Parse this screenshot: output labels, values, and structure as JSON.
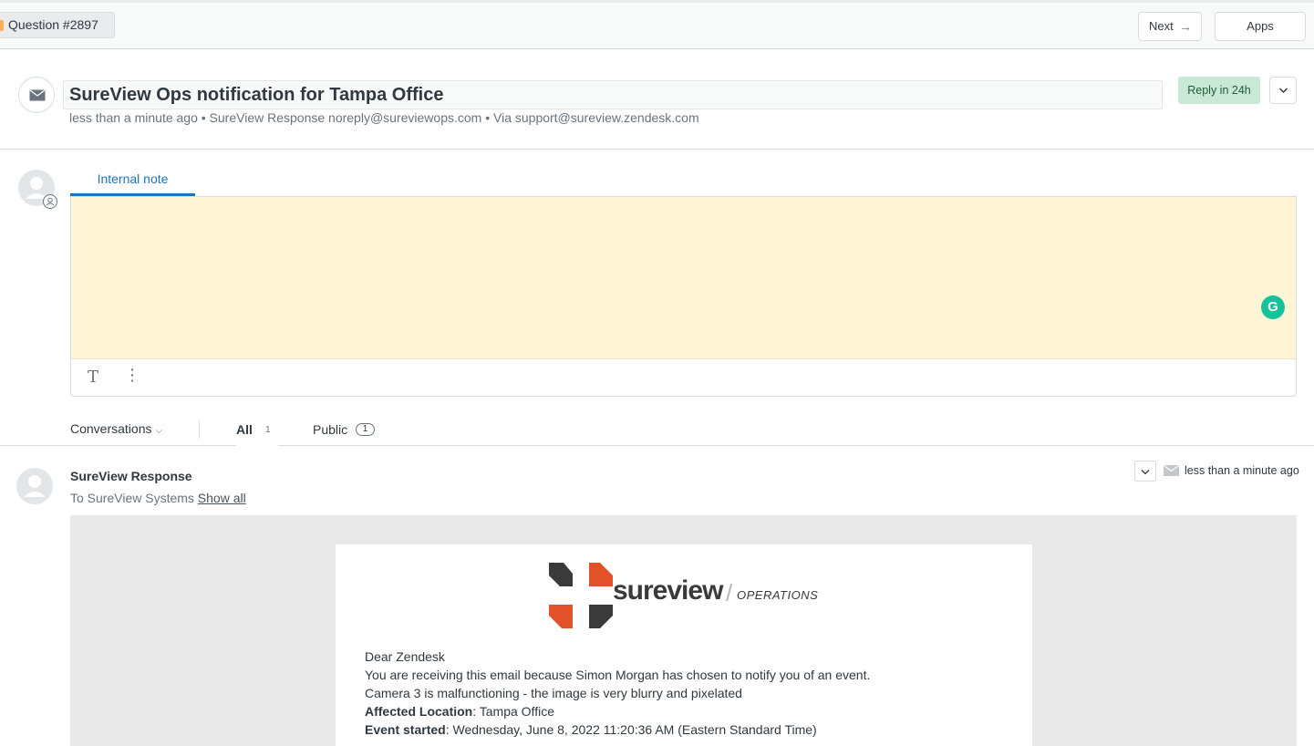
{
  "topbar": {
    "ticket_tab": "Question #2897",
    "next_label": "Next",
    "apps_label": "Apps"
  },
  "ticket": {
    "subject": "SureView Ops notification for Tampa Office",
    "meta": "less than a minute ago • SureView Response   noreply@sureviewops.com • Via support@sureview.zendesk.com",
    "sla_badge": "Reply in 24h"
  },
  "composer": {
    "tab_label": "Internal note",
    "grammarly_letter": "G",
    "tool_text": "T",
    "tool_more": "⋮"
  },
  "filters": {
    "conversations_label": "Conversations",
    "all_label": "All",
    "all_count": "1",
    "public_label": "Public",
    "public_count": "1"
  },
  "message": {
    "author": "SureView Response",
    "to_prefix": "To SureView Systems",
    "show_all": "Show all",
    "time": "less than a minute ago",
    "email": {
      "logo_word": "sureview",
      "logo_slash": "/",
      "logo_suffix": "OPERATIONS",
      "greeting": "Dear Zendesk",
      "line1": "You are receiving this email because Simon Morgan has chosen to notify you of an event.",
      "line2": "Camera 3 is malfunctioning - the image is very blurry and pixelated",
      "location_label": "Affected Location",
      "location_value": ": Tampa Office",
      "started_label": "Event started",
      "started_value": ": Wednesday, June 8, 2022 11:20:36 AM (Eastern Standard Time)"
    }
  },
  "colors": {
    "accent": "#1f73b7",
    "note_bg": "#fef4d6",
    "sla_bg": "#c9e8d6",
    "logo_dark": "#3a3a3a",
    "logo_orange": "#e2522a"
  }
}
